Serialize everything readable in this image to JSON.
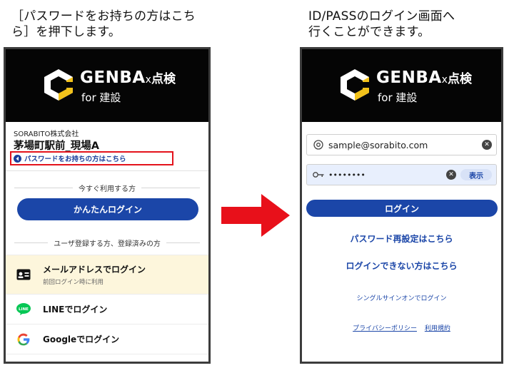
{
  "captions": {
    "left": "［パスワードをお持ちの方はこち\nら］を押下します。",
    "right": "ID/PASSのログイン画面へ\n行くことができます。"
  },
  "brand": {
    "name": "GENBA",
    "x": "x",
    "suffix": "点検",
    "sub": "for 建設"
  },
  "left_screen": {
    "company": "SORABITO株式会社",
    "site": "茅場町駅前_現場A",
    "password_link": "パスワードをお持ちの方はこちら",
    "divider_now": "今すぐ利用する方",
    "easy_login_button": "かんたんログイン",
    "divider_registered": "ユーザ登録する方、登録済みの方",
    "mail_login": "メールアドレスでログイン",
    "mail_login_sub": "前回ログイン時に利用",
    "line_login": "LINEでログイン",
    "line_icon_text": "LINE",
    "google_login": "Googleでログイン"
  },
  "right_screen": {
    "email_value": "sample@sorabito.com",
    "password_value": "••••••••",
    "show_button": "表示",
    "login_button": "ログイン",
    "reset_link": "パスワード再設定はこちら",
    "cant_login_link": "ログインできない方はこちら",
    "sso_link": "シングルサインオンでログイン",
    "privacy_link": "プライバシーポリシー",
    "terms_link": "利用規約"
  },
  "colors": {
    "primary": "#1b46a8",
    "highlight_border": "#e4121c",
    "arrow": "#e8101a",
    "mail_row_bg": "#fdf6dc",
    "line_green": "#06c755"
  }
}
